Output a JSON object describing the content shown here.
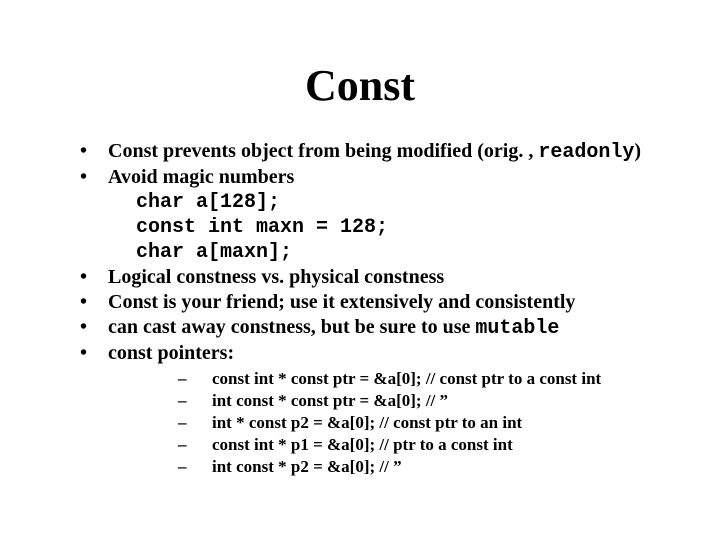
{
  "title": "Const",
  "bullets": {
    "b1_pre": "Const prevents object from being modified (orig. , ",
    "b1_code": "readonly",
    "b1_post": ")",
    "b2": "Avoid magic numbers",
    "codeblock": "char a[128];\nconst int maxn = 128;\nchar a[maxn];",
    "b3": "Logical constness vs. physical constness",
    "b4": "Const is your friend; use it extensively and consistently",
    "b5_pre": "can cast away constness, but be sure to use ",
    "b5_code": "mutable",
    "b6": "const pointers:"
  },
  "sub": [
    "const int * const ptr = &a[0];  // const ptr to a const int",
    "int const * const ptr = &a[0];  // ”",
    "int * const p2 = &a[0];  // const ptr to an int",
    "const int * p1 = &a[0];  // ptr to a const int",
    "int const * p2 = &a[0];  // ”"
  ]
}
